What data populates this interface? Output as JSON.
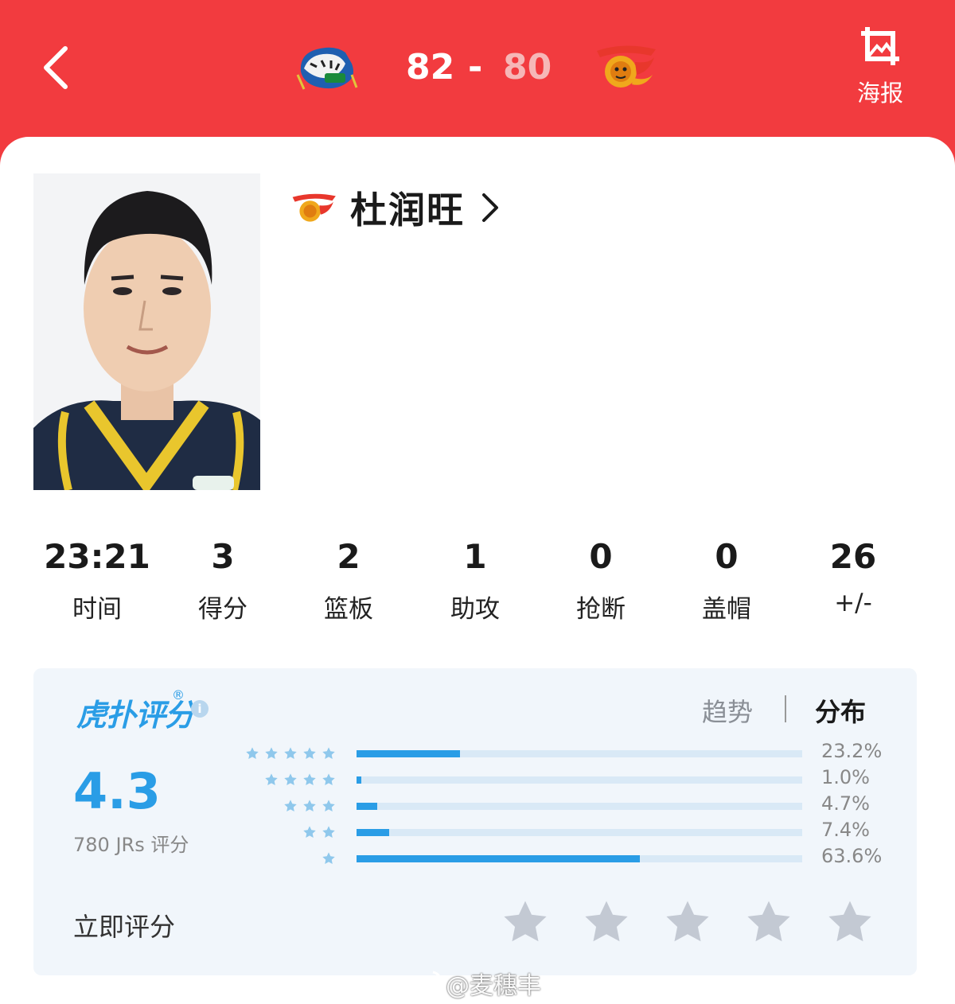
{
  "header": {
    "score_home": "82",
    "score_separator": "-",
    "score_away": "80",
    "poster_label": "海报",
    "bg_color": "#f23b3f"
  },
  "player": {
    "name": "杜润旺",
    "chevron": ">"
  },
  "stats": [
    {
      "value": "23:21",
      "label": "时间"
    },
    {
      "value": "3",
      "label": "得分"
    },
    {
      "value": "2",
      "label": "篮板"
    },
    {
      "value": "1",
      "label": "助攻"
    },
    {
      "value": "0",
      "label": "抢断"
    },
    {
      "value": "0",
      "label": "盖帽"
    },
    {
      "value": "26",
      "label": "+/-"
    }
  ],
  "rating": {
    "brand": "虎扑评分",
    "brand_mark": "®",
    "info": "i",
    "tab_trend": "趋势",
    "tab_distribution": "分布",
    "average": "4.3",
    "count_text": "780 JRs 评分",
    "distribution": [
      {
        "stars": 5,
        "percent": 23.2,
        "label": "23.2%"
      },
      {
        "stars": 4,
        "percent": 1.0,
        "label": "1.0%"
      },
      {
        "stars": 3,
        "percent": 4.7,
        "label": "4.7%"
      },
      {
        "stars": 2,
        "percent": 7.4,
        "label": "7.4%"
      },
      {
        "stars": 1,
        "percent": 63.6,
        "label": "63.6%"
      }
    ],
    "rate_now": "立即评分",
    "accent_color": "#2a9de6"
  },
  "watermark": "@麦穗丰"
}
